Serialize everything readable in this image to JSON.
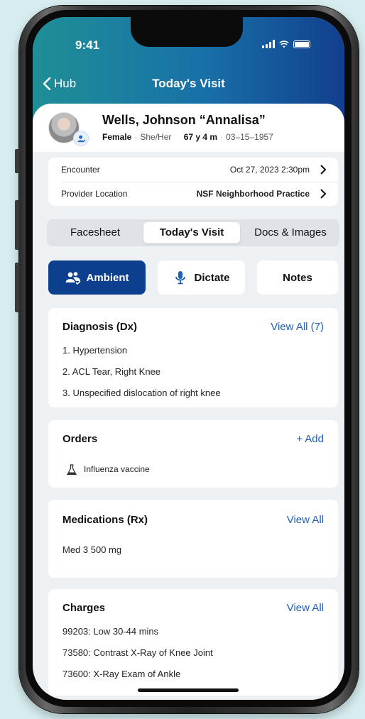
{
  "status": {
    "time": "9:41"
  },
  "nav": {
    "back_label": "Hub",
    "title": "Today's Visit"
  },
  "patient": {
    "name": "Wells, Johnson “Annalisa”",
    "sex": "Female",
    "pronouns": "She/Her",
    "age": "67 y 4 m",
    "dob": "03–15–1957"
  },
  "encounter": {
    "rows": [
      {
        "label": "Encounter",
        "value": "Oct 27, 2023 2:30pm"
      },
      {
        "label": "Provider Location",
        "value": "NSF Neighborhood Practice"
      }
    ]
  },
  "tabs": {
    "items": [
      "Facesheet",
      "Today's Visit",
      "Docs & Images"
    ],
    "selected": "Today's Visit"
  },
  "modes": {
    "items": [
      "Ambient",
      "Dictate",
      "Notes"
    ],
    "selected": "Ambient"
  },
  "diagnosis": {
    "title": "Diagnosis (Dx)",
    "link": "View All (7)",
    "items": [
      "1. Hypertension",
      "2. ACL Tear, Right Knee",
      "3. Unspecified dislocation of right knee"
    ]
  },
  "orders": {
    "title": "Orders",
    "link": "+ Add",
    "items": [
      "Influenza vaccine"
    ]
  },
  "medications": {
    "title": "Medications (Rx)",
    "link": "View All",
    "items": [
      "Med 3 500 mg"
    ]
  },
  "charges": {
    "title": "Charges",
    "link": "View All",
    "items": [
      "99203: Low 30-44 mins",
      "73580: Contrast X-Ray of Knee Joint",
      "73600: X-Ray Exam of Ankle"
    ]
  },
  "colors": {
    "accent_blue": "#0d3f8f",
    "link_blue": "#1e5fb8",
    "header_teal": "#1f8f96"
  }
}
